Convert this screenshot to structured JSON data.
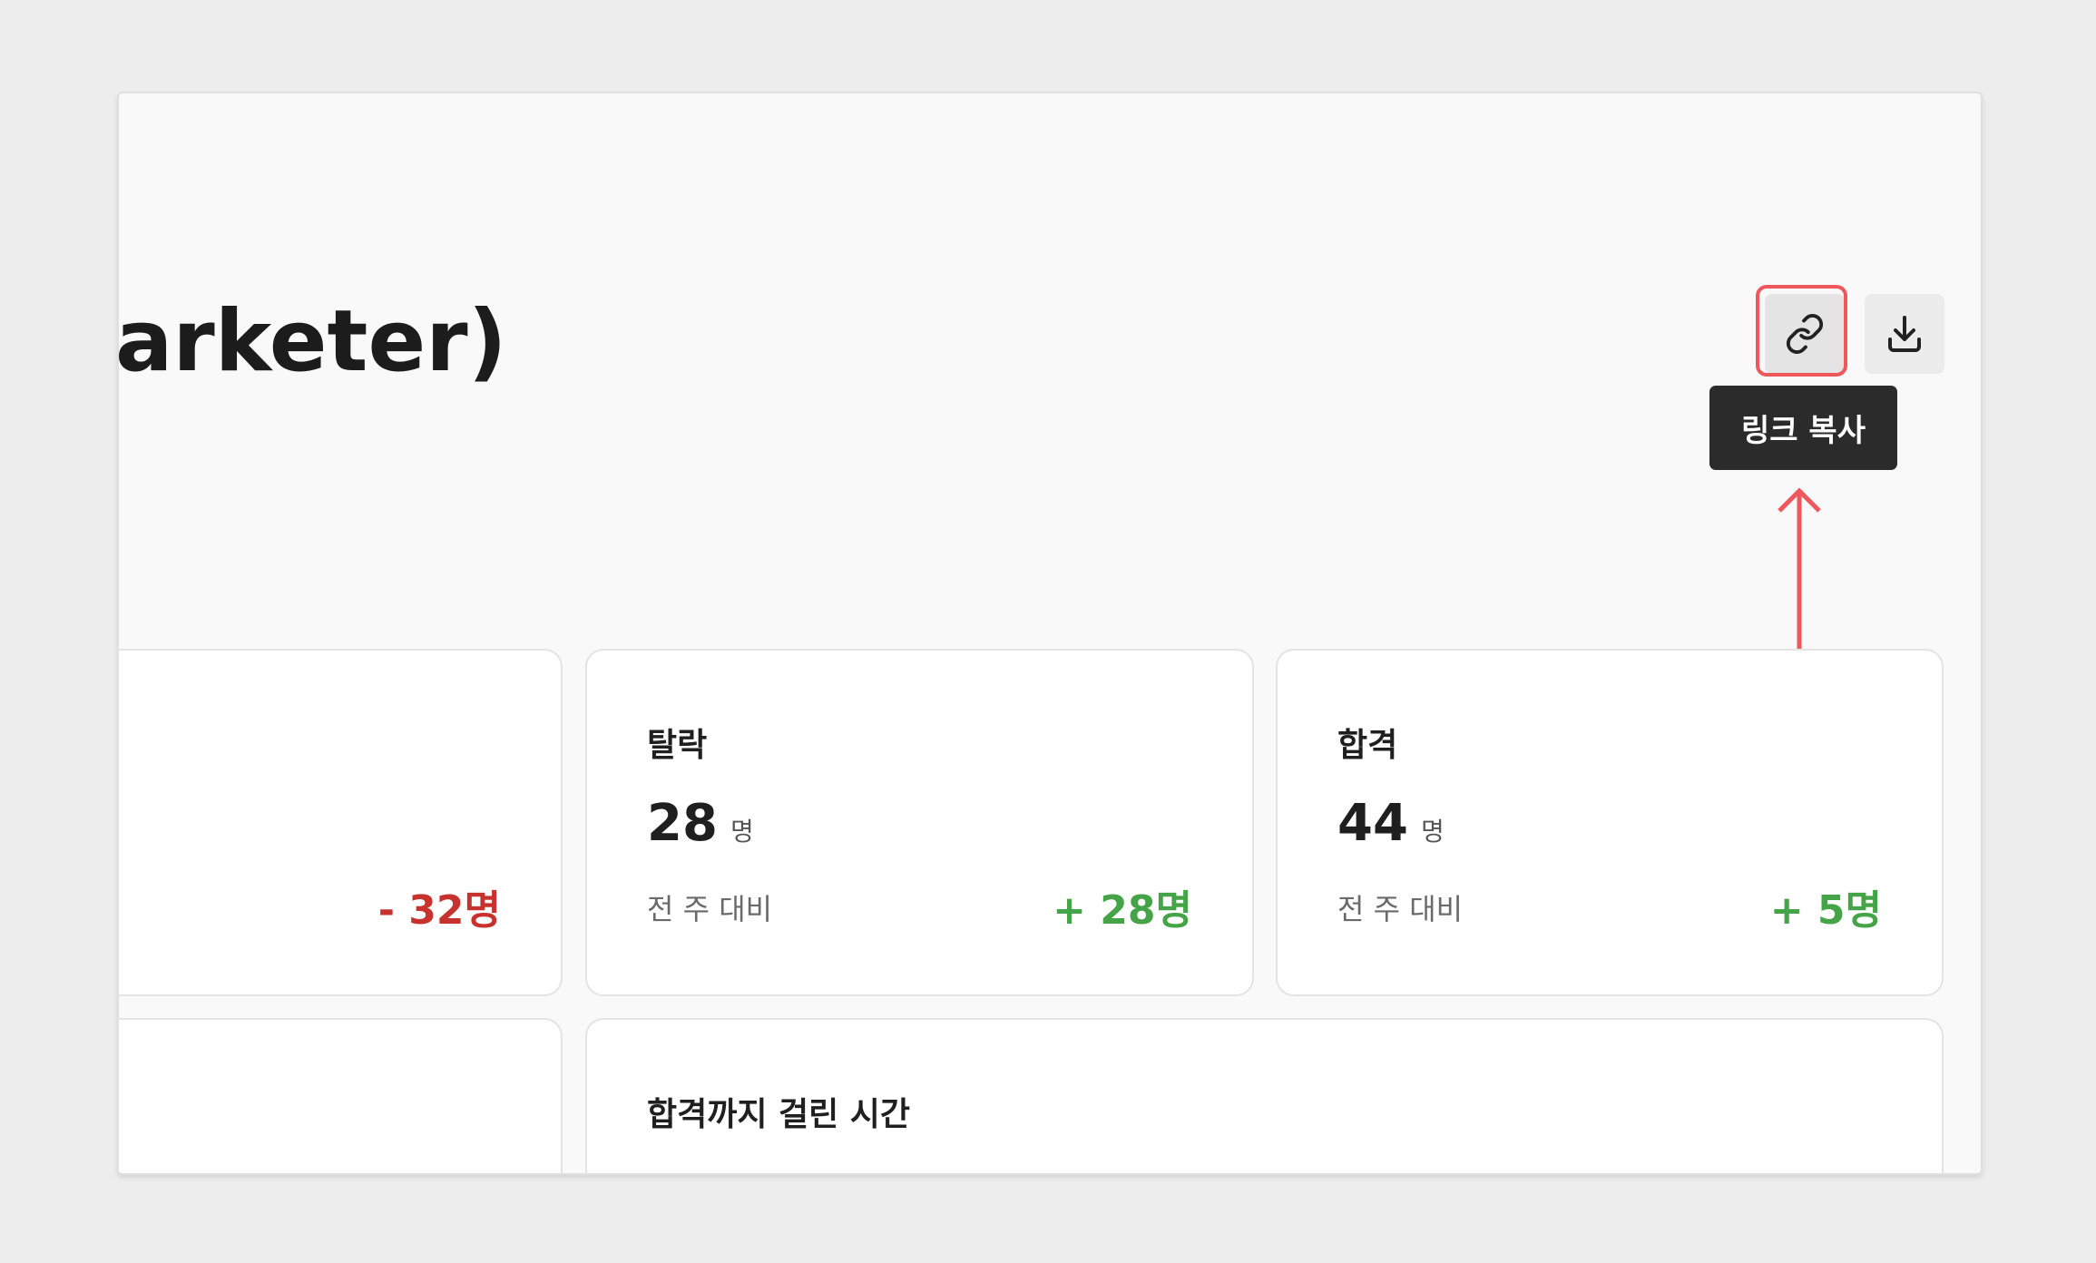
{
  "page": {
    "title": "arketer)"
  },
  "toolbar": {
    "link_icon": "link-icon",
    "download_icon": "download-icon",
    "tooltip": "링크 복사"
  },
  "cards": [
    {
      "delta": "- 32명",
      "delta_color": "#c8322e"
    },
    {
      "label": "탈락",
      "value": "28",
      "unit": "명",
      "compare_label": "전 주 대비",
      "delta": "+ 28명",
      "delta_color": "#45a447"
    },
    {
      "label": "합격",
      "value": "44",
      "unit": "명",
      "compare_label": "전 주 대비",
      "delta": "+ 5명",
      "delta_color": "#45a447"
    }
  ],
  "bottom_cards": [
    {},
    {
      "label": "합격까지 걸린 시간"
    }
  ],
  "colors": {
    "highlight": "#f0575c",
    "tooltip_bg": "#2b2b2b",
    "positive": "#45a447",
    "negative": "#c8322e"
  }
}
